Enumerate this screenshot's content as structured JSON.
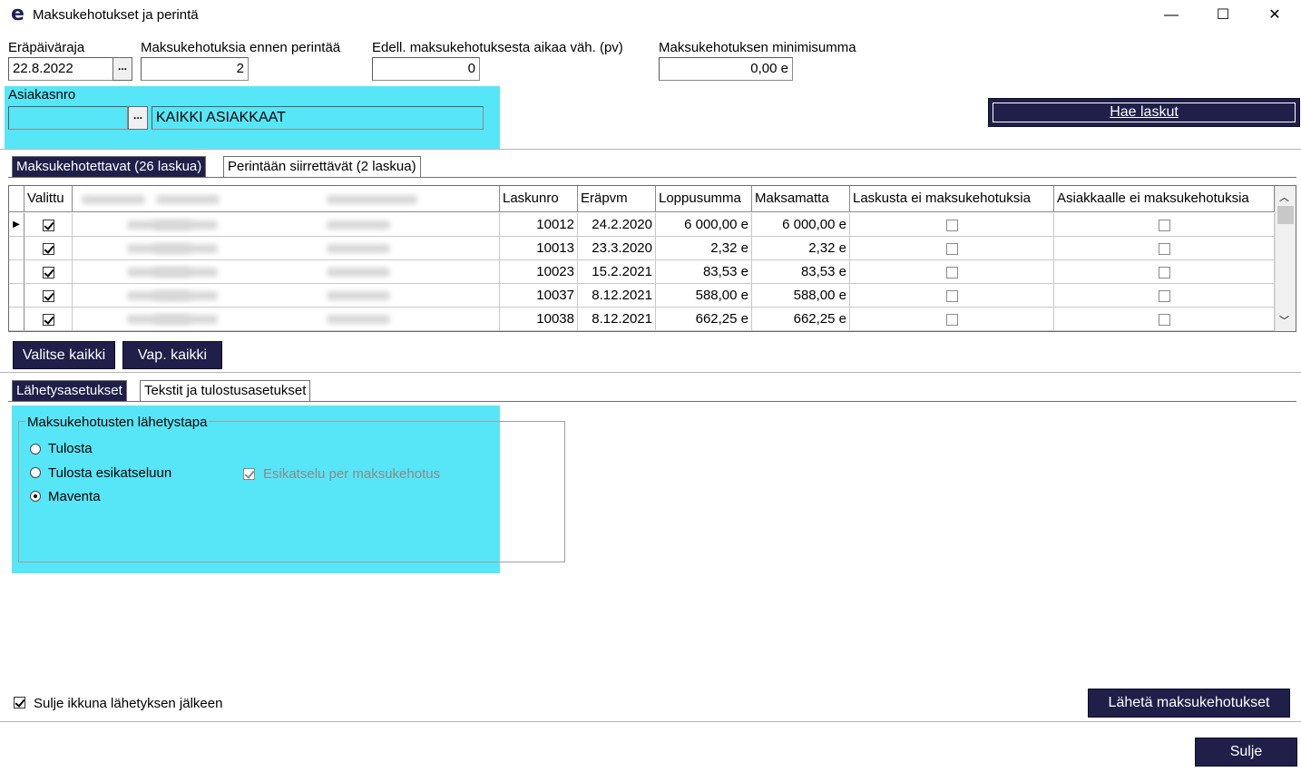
{
  "window": {
    "title": "Maksukehotukset ja perintä",
    "app_icon": "e",
    "minimize": "—",
    "maximize": "☐",
    "close": "✕"
  },
  "filters": {
    "due_date_label": "Eräpäiväraja",
    "due_date_value": "22.8.2022",
    "reminders_label": "Maksukehotuksia ennen perintää",
    "reminders_value": "2",
    "interval_label": "Edell. maksukehotuksesta aikaa väh. (pv)",
    "interval_value": "0",
    "min_sum_label": "Maksukehotuksen minimisumma",
    "min_sum_value": "0,00 e",
    "customer_label": "Asiakasnro",
    "customer_value": "",
    "customer_name": "KAIKKI ASIAKKAAT",
    "picker": "..."
  },
  "fetch_button": "Hae laskut",
  "tabs": [
    {
      "label": "Maksukehotettavat (26 laskua)",
      "active": true
    },
    {
      "label": "Perintään siirrettävät (2 laskua)",
      "active": false
    }
  ],
  "grid": {
    "columns": [
      "Valittu",
      "Laskunro",
      "Eräpvm",
      "Loppusumma",
      "Maksamatta",
      "Laskusta ei maksukehotuksia",
      "Asiakkaalle ei maksukehotuksia"
    ],
    "rows": [
      {
        "selected": true,
        "invoice": "10012",
        "due": "24.2.2020",
        "total": "6 000,00 e",
        "unpaid": "6 000,00 e",
        "no_invoice_reminders": false,
        "no_customer_reminders": false
      },
      {
        "selected": true,
        "invoice": "10013",
        "due": "23.3.2020",
        "total": "2,32 e",
        "unpaid": "2,32 e",
        "no_invoice_reminders": false,
        "no_customer_reminders": false
      },
      {
        "selected": true,
        "invoice": "10023",
        "due": "15.2.2021",
        "total": "83,53 e",
        "unpaid": "83,53 e",
        "no_invoice_reminders": false,
        "no_customer_reminders": false
      },
      {
        "selected": true,
        "invoice": "10037",
        "due": "8.12.2021",
        "total": "588,00 e",
        "unpaid": "588,00 e",
        "no_invoice_reminders": false,
        "no_customer_reminders": false
      },
      {
        "selected": true,
        "invoice": "10038",
        "due": "8.12.2021",
        "total": "662,25 e",
        "unpaid": "662,25 e",
        "no_invoice_reminders": false,
        "no_customer_reminders": false
      }
    ]
  },
  "select_all": "Valitse kaikki",
  "deselect_all": "Vap. kaikki",
  "settings_tabs": [
    {
      "label": "Lähetysasetukset",
      "active": true
    },
    {
      "label": "Tekstit ja tulostusasetukset",
      "active": false
    }
  ],
  "send_method": {
    "legend": "Maksukehotusten lähetystapa",
    "options": [
      {
        "label": "Tulosta",
        "selected": false
      },
      {
        "label": "Tulosta esikatseluun",
        "selected": false
      },
      {
        "label": "Maventa",
        "selected": true
      }
    ],
    "preview_per_reminder": "Esikatselu per maksukehotus"
  },
  "close_after_send": "Sulje ikkuna lähetyksen jälkeen",
  "send_button": "Lähetä maksukehotukset",
  "close_button": "Sulje",
  "colors": {
    "navy": "#1f1f49",
    "highlight": "#57e6f7"
  }
}
